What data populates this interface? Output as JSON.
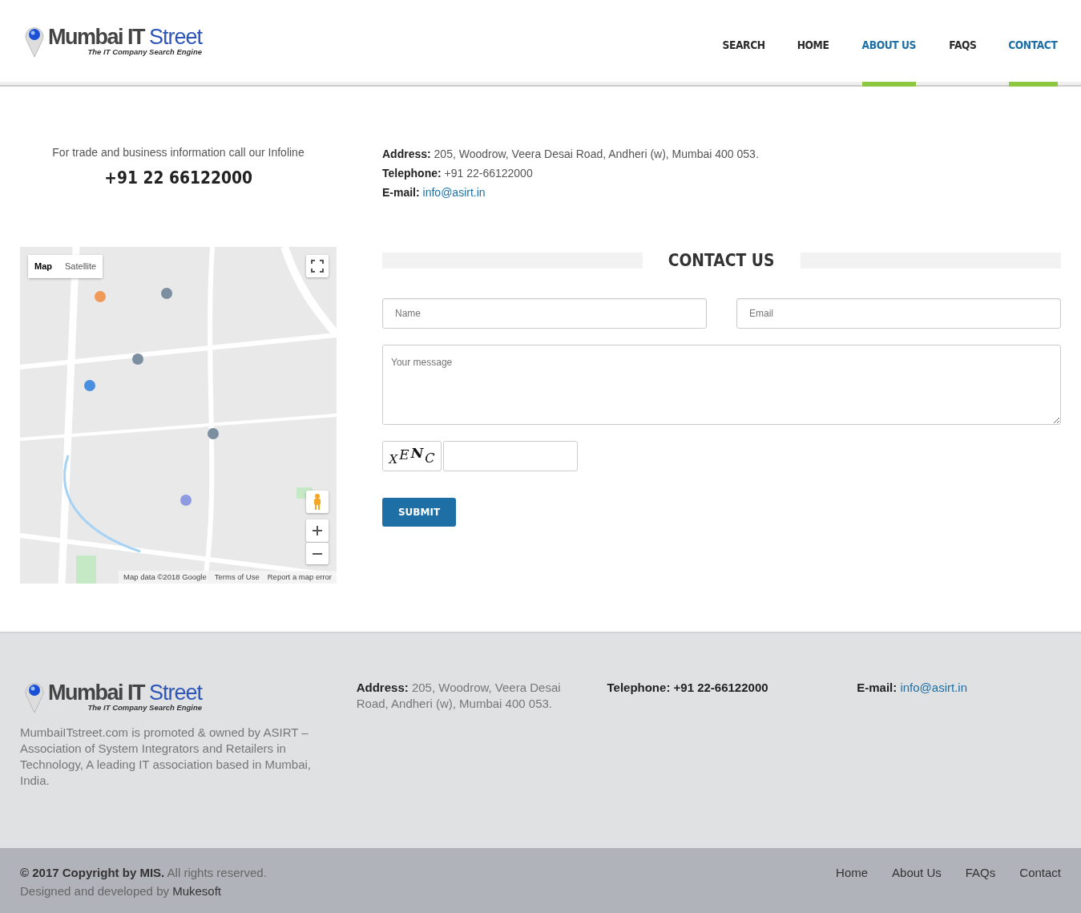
{
  "header": {
    "logo": {
      "name_dark": "Mumbai IT",
      "name_accent": "Street",
      "tagline": "The IT Company Search Engine"
    },
    "nav": [
      {
        "label": "SEARCH",
        "selected": false
      },
      {
        "label": "HOME",
        "selected": false
      },
      {
        "label": "ABOUT US",
        "selected": true
      },
      {
        "label": "FAQS",
        "selected": false
      },
      {
        "label": "CONTACT",
        "selected": true
      }
    ]
  },
  "infoline": {
    "text": "For trade and business information call our Infoline",
    "phone": "+91 22 66122000"
  },
  "contact_details": [
    {
      "label": "Address:",
      "value": "205, Woodrow, Veera Desai Road, Andheri (w), Mumbai 400 053.",
      "kind": "text"
    },
    {
      "label": "Telephone:",
      "value": "+91 22-66122000",
      "kind": "text"
    },
    {
      "label": "E-mail:",
      "value": "info@asirt.in",
      "kind": "link"
    }
  ],
  "map": {
    "kind": "picture",
    "map_types": [
      {
        "label": "Map",
        "selected": true
      },
      {
        "label": "Satellite",
        "selected": false
      }
    ],
    "attribution": [
      "Map data ©2018 Google",
      "Terms of Use",
      "Report a map error"
    ]
  },
  "contact_form": {
    "title": "CONTACT US",
    "fields": [
      {
        "placeholder": "Name"
      },
      {
        "placeholder": "Email"
      }
    ],
    "message": {
      "placeholder": "Your message"
    },
    "captcha": "XENC",
    "submit": "SUBMIT"
  },
  "footer": {
    "logo": {
      "name_dark": "Mumbai IT",
      "name_accent": "Street",
      "tagline": "The IT Company Search Engine"
    },
    "about": "MumbaiITstreet.com is promoted & owned by ASIRT – Association of System Integrators and Retailers in Technology, A leading IT association based in Mumbai, India.",
    "contacts": [
      {
        "label": "Address:",
        "value": "205, Woodrow, Veera Desai Road, Andheri (w), Mumbai 400 053.",
        "kind": "text"
      },
      {
        "label": "Telephone:",
        "value": "+91 22-66122000",
        "kind": "strong"
      },
      {
        "label": "E-mail:",
        "value": "info@asirt.in",
        "kind": "link"
      }
    ]
  },
  "bottom_bar": {
    "copyright": "**© 2017 Copyright by MIS.** All rights reserved.",
    "credit_prefix": "Designed and developed by",
    "credit_link": "Mukesoft",
    "links": [
      "Home",
      "About Us",
      "FAQs",
      "Contact"
    ]
  }
}
